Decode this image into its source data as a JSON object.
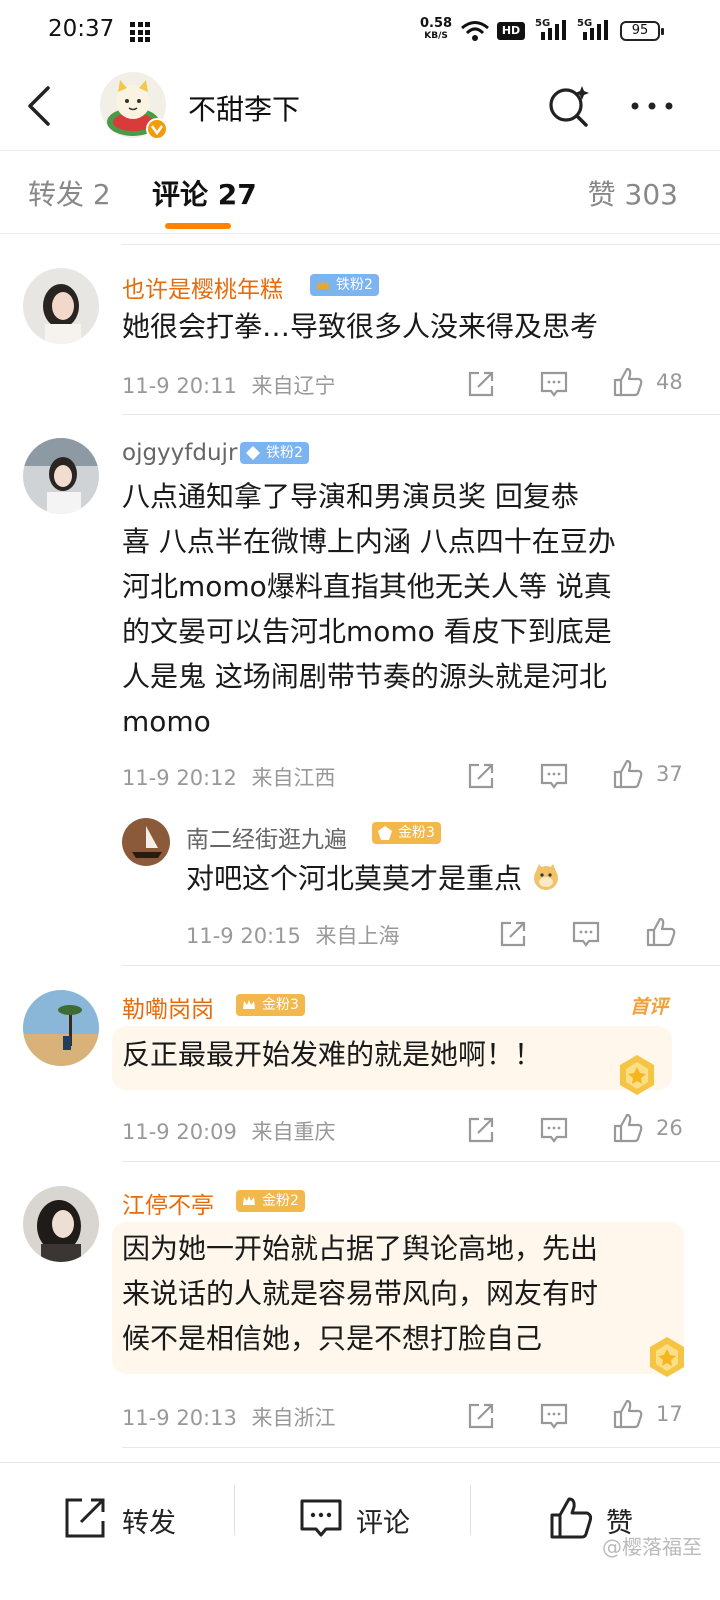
{
  "status_bar": {
    "time": "20:37",
    "net_speed": "0.58",
    "net_unit": "KB/S",
    "hd_label": "HD",
    "signal1": "5G",
    "signal2": "5G",
    "battery": "95"
  },
  "header": {
    "title": "不甜李下"
  },
  "tabs": {
    "repost": "转发 2",
    "comment": "评论 27",
    "like": "赞 303"
  },
  "comments": [
    {
      "username": "也许是樱桃年糕",
      "badge": "铁粉2",
      "text": "她很会打拳…导致很多人没来得及思考",
      "time": "11-9 20:11",
      "location": "来自辽宁",
      "likes": "48"
    },
    {
      "username": "ojgyyfdujr",
      "badge": "铁粉2",
      "text_lines": [
        "八点通知拿了导演和男演员奖 回复恭",
        "喜 八点半在微博上内涵 八点四十在豆办",
        "河北momo爆料直指其他无关人等 说真",
        "的文晏可以告河北momo 看皮下到底是",
        "人是鬼 这场闹剧带节奏的源头就是河北",
        "momo"
      ],
      "time": "11-9 20:12",
      "location": "来自江西",
      "likes": "37"
    },
    {
      "username": "南二经街逛九遍",
      "badge": "金粉3",
      "text": "对吧这个河北莫莫才是重点",
      "time": "11-9 20:15",
      "location": "来自上海"
    },
    {
      "username": "勒嘞岗岗",
      "badge": "金粉3",
      "first_label": "首评",
      "text": "反正最最开始发难的就是她啊！！",
      "time": "11-9 20:09",
      "location": "来自重庆",
      "likes": "26"
    },
    {
      "username": "江停不亭",
      "badge": "金粉2",
      "text_lines": [
        "因为她一开始就占据了舆论高地，先出",
        "来说话的人就是容易带风向，网友有时",
        "候不是相信她，只是不想打脸自己"
      ],
      "time": "11-9 20:13",
      "location": "来自浙江",
      "likes": "17"
    }
  ],
  "bottom_bar": {
    "repost": "转发",
    "comment": "评论",
    "like": "赞",
    "watermark": "@樱落福至"
  },
  "colors": {
    "accent": "#ff8200",
    "username_orange": "#e86b0a",
    "iron_fan_blue": "#7cb4f2",
    "gold_fan": "#f2b84c"
  }
}
